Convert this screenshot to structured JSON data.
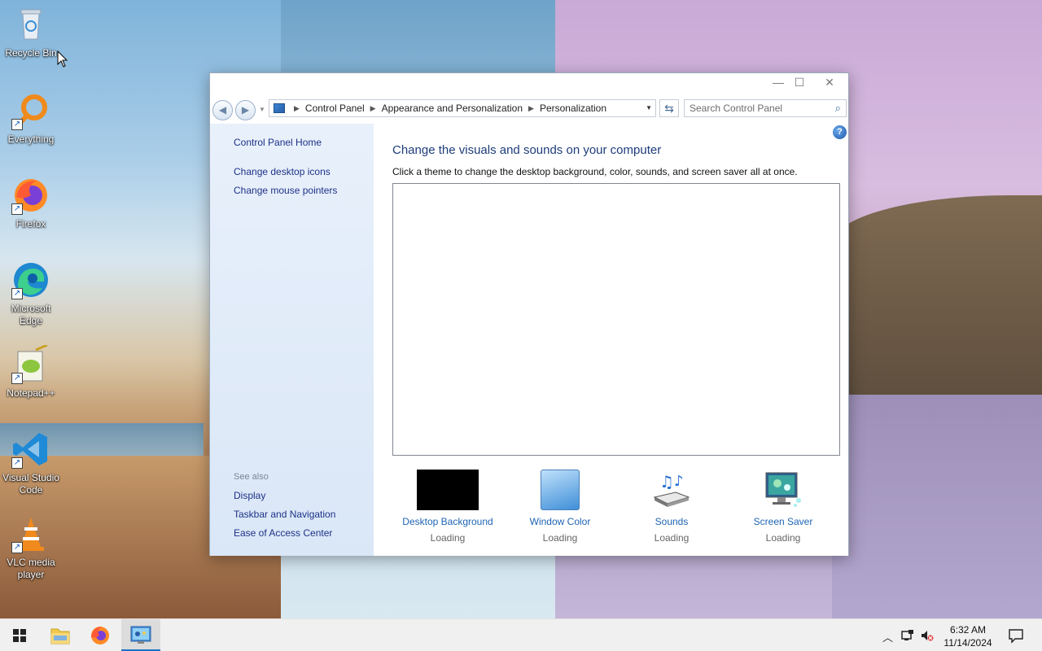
{
  "desktop": {
    "icons": [
      {
        "label": "Recycle Bin"
      },
      {
        "label": "Everything"
      },
      {
        "label": "Firefox"
      },
      {
        "label": "Microsoft Edge"
      },
      {
        "label": "Notepad++"
      },
      {
        "label": "Visual Studio Code"
      },
      {
        "label": "VLC media player"
      }
    ]
  },
  "window": {
    "controls": {
      "minimize": "—",
      "maximize": "☐",
      "close": "✕"
    },
    "breadcrumb": [
      "Control Panel",
      "Appearance and Personalization",
      "Personalization"
    ],
    "search_placeholder": "Search Control Panel",
    "sidebar": {
      "home": "Control Panel Home",
      "links": [
        "Change desktop icons",
        "Change mouse pointers"
      ],
      "see_also_title": "See also",
      "see_also": [
        "Display",
        "Taskbar and Navigation",
        "Ease of Access Center"
      ]
    },
    "content": {
      "heading": "Change the visuals and sounds on your computer",
      "subtitle": "Click a theme to change the desktop background, color, sounds, and screen saver all at once.",
      "options": [
        {
          "label": "Desktop Background",
          "status": "Loading"
        },
        {
          "label": "Window Color",
          "status": "Loading"
        },
        {
          "label": "Sounds",
          "status": "Loading"
        },
        {
          "label": "Screen Saver",
          "status": "Loading"
        }
      ]
    }
  },
  "taskbar": {
    "clock_time": "6:32 AM",
    "clock_date": "11/14/2024"
  },
  "colors": {
    "accent": "#1a73c9",
    "link": "#1e64b4",
    "heading": "#1e3d7a"
  }
}
